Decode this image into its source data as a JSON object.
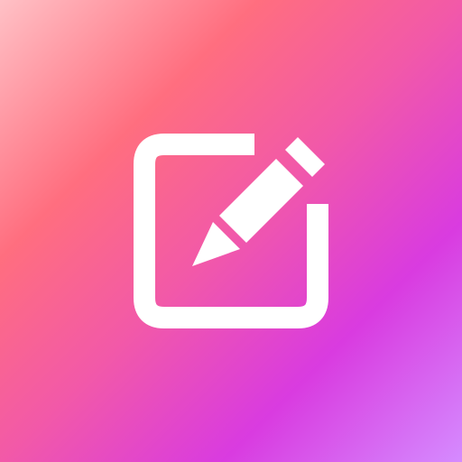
{
  "app_icon": {
    "icon_name": "edit-icon",
    "background_gradient": [
      "#FFC1C6",
      "#FF6E7F",
      "#F259A8",
      "#D93BE0",
      "#D58BFF"
    ],
    "glyph_color": "#FFFFFF"
  }
}
